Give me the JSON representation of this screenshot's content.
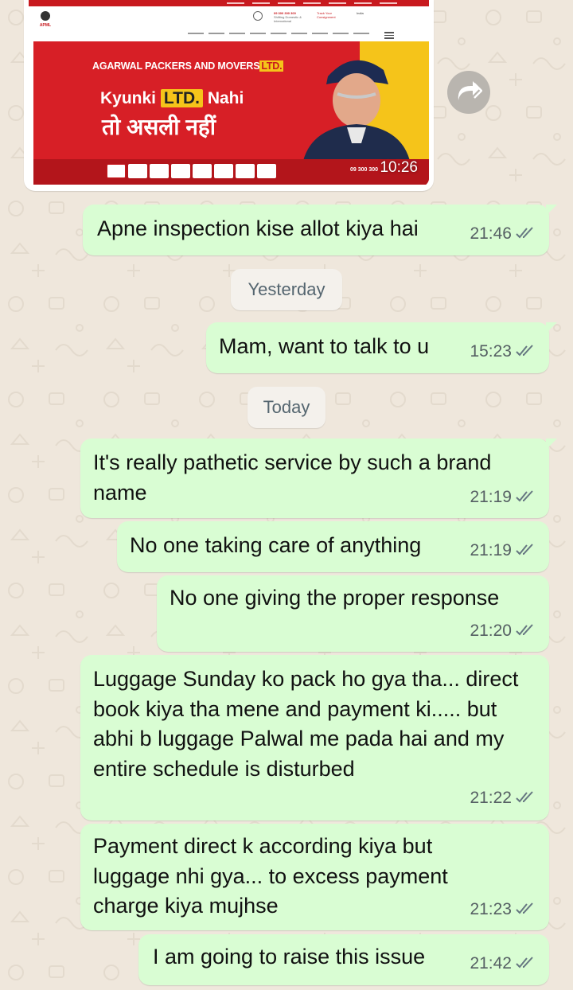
{
  "image_message": {
    "time": "10:26",
    "site": {
      "logo_text": "APML",
      "contact_phone": "09 300 300 300",
      "contact_tagline": "Shifting Domestic & International",
      "track_label": "Track Your Consignment",
      "country": "India",
      "company_name": "AGARWAL PACKERS AND MOVERS",
      "company_suffix": "LTD.",
      "slogan_start": "Kyunki",
      "slogan_ltd": "LTD.",
      "slogan_end": "Nahi",
      "slogan_hindi": "तो असली नहीं",
      "strip_phone": "09 300 300"
    }
  },
  "forward_button": {
    "icon": "forward-icon"
  },
  "messages": [
    {
      "text": "Apne inspection kise allot kiya hai",
      "time": "21:46",
      "status": "read"
    },
    {
      "text": "Mam, want to talk to u",
      "time": "15:23",
      "status": "read"
    },
    {
      "text": "It's really pathetic service by such a brand name",
      "time": "21:19",
      "status": "read"
    },
    {
      "text": "No one taking care of anything",
      "time": "21:19",
      "status": "read"
    },
    {
      "text": "No one giving the proper response",
      "time": "21:20",
      "status": "read"
    },
    {
      "text": "Luggage Sunday ko pack ho gya tha... direct book kiya tha mene and payment ki..... but abhi b luggage Palwal me pada hai and my entire schedule is disturbed",
      "time": "21:22",
      "status": "read"
    },
    {
      "text": "Payment direct k according kiya but luggage nhi gya... to excess payment charge kiya mujhse",
      "time": "21:23",
      "status": "read"
    },
    {
      "text": "I am going to raise this issue",
      "time": "21:42",
      "status": "read"
    }
  ],
  "date_separators": {
    "yesterday": "Yesterday",
    "today": "Today"
  },
  "colors": {
    "bubble": "#d9fdd3",
    "wallpaper": "#efe7dc",
    "tick": "#667781",
    "brand_red": "#d71f26",
    "brand_yellow": "#f5c41a"
  }
}
